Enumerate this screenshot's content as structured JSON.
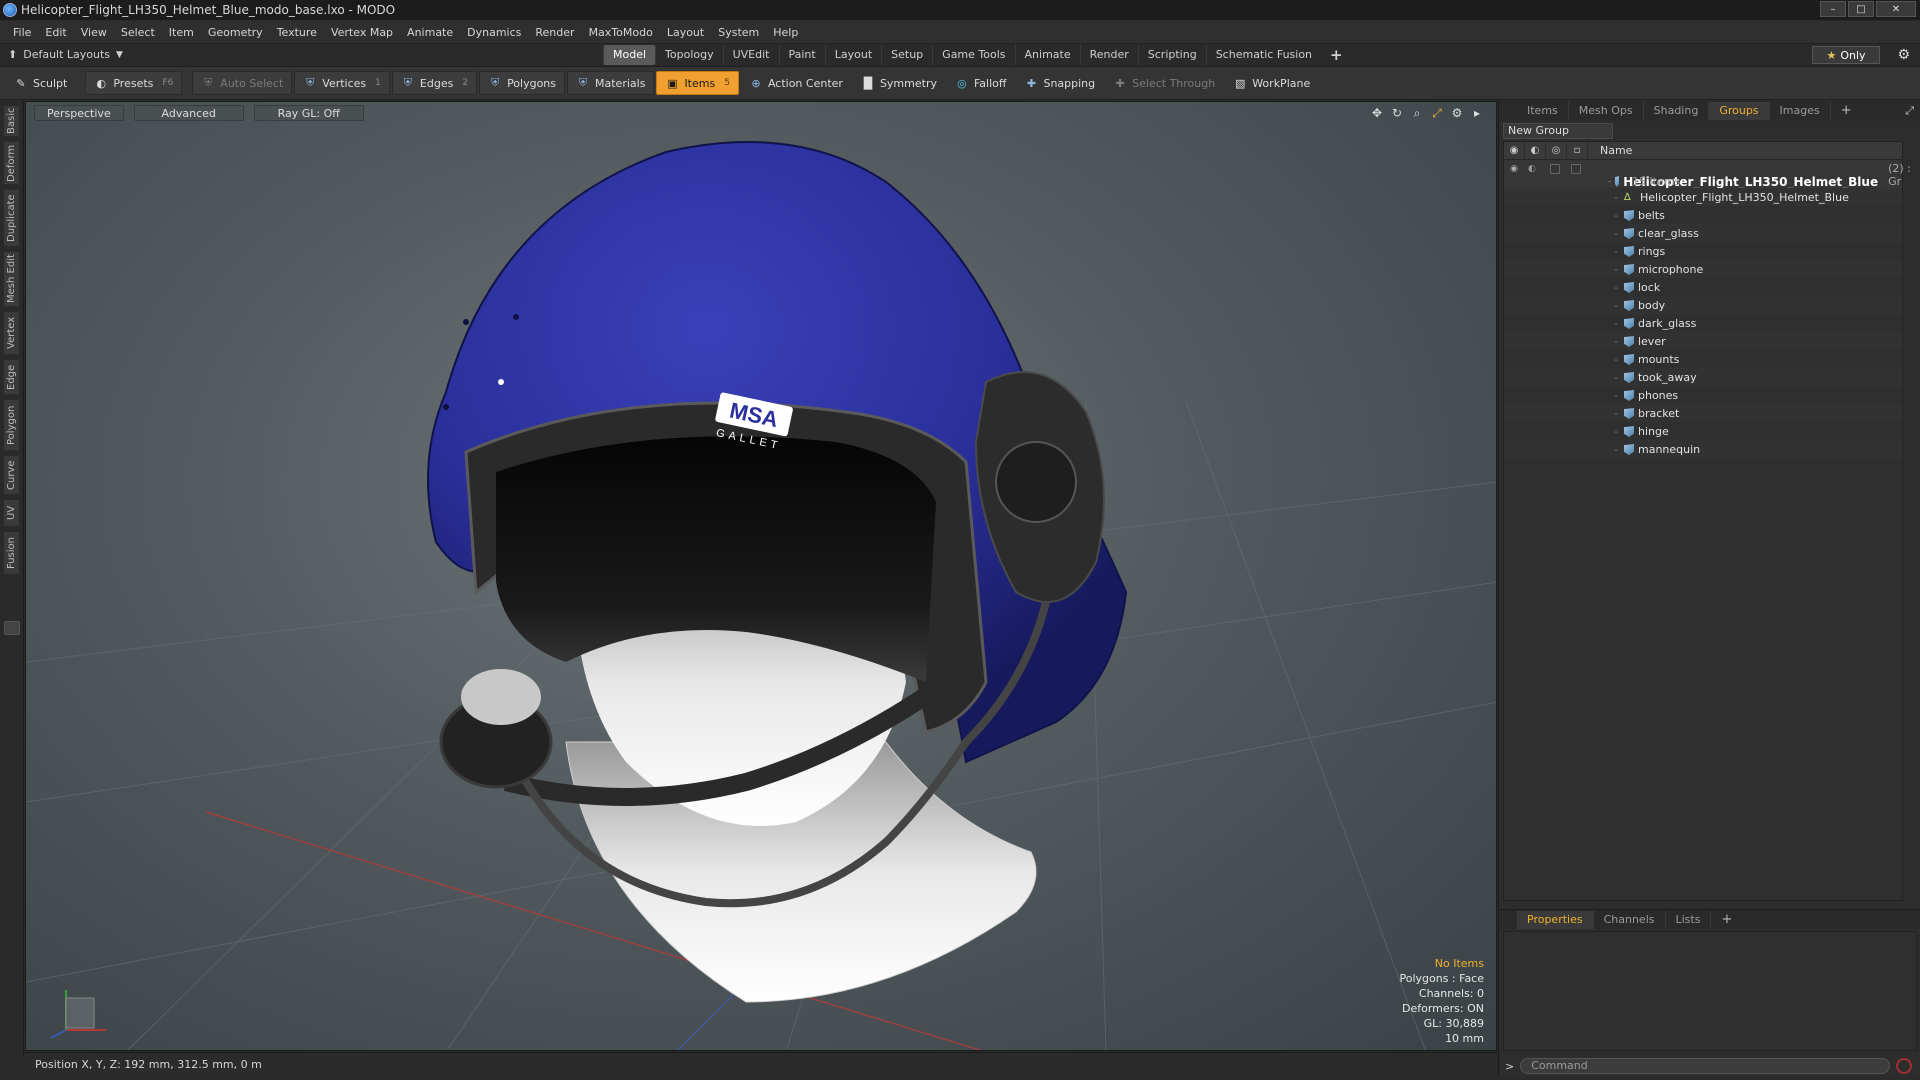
{
  "window": {
    "title": "Helicopter_Flight_LH350_Helmet_Blue_modo_base.lxo - MODO",
    "controls": [
      "–",
      "□",
      "✕"
    ]
  },
  "menu": [
    "File",
    "Edit",
    "View",
    "Select",
    "Item",
    "Geometry",
    "Texture",
    "Vertex Map",
    "Animate",
    "Dynamics",
    "Render",
    "MaxToModo",
    "Layout",
    "System",
    "Help"
  ],
  "layout_bar": {
    "layout_label": "Default Layouts",
    "tabs": [
      "Model",
      "Topology",
      "UVEdit",
      "Paint",
      "Layout",
      "Setup",
      "Game Tools",
      "Animate",
      "Render",
      "Scripting",
      "Schematic Fusion"
    ],
    "active_tab": "Model",
    "plus": "+",
    "only_label": "Only"
  },
  "toolbar": {
    "sculpt": "Sculpt",
    "presets": "Presets",
    "presets_key": "F6",
    "auto_select": "Auto Select",
    "vertices": "Vertices",
    "vertices_count": "1",
    "edges": "Edges",
    "edges_count": "2",
    "polygons": "Polygons",
    "materials": "Materials",
    "items": "Items",
    "items_count": "5",
    "action_center": "Action Center",
    "symmetry": "Symmetry",
    "falloff": "Falloff",
    "snapping": "Snapping",
    "select_through": "Select Through",
    "workplane": "WorkPlane"
  },
  "left_tabs": [
    "Basic",
    "Deform",
    "Duplicate",
    "Mesh Edit",
    "Vertex",
    "Edge",
    "Polygon",
    "Curve",
    "UV",
    "Fusion"
  ],
  "viewport": {
    "view_mode": "Perspective",
    "shading": "Advanced",
    "raygl": "Ray GL: Off",
    "logo_line1": "MSA",
    "logo_line2": "GALLET",
    "stats": {
      "no_items": "No Items",
      "polygons": "Polygons : Face",
      "channels": "Channels: 0",
      "deformers": "Deformers: ON",
      "gl": "GL: 30,889",
      "scale": "10 mm"
    }
  },
  "status": {
    "position": "Position X, Y, Z:  192 mm, 312.5 mm, 0 m"
  },
  "right_panel": {
    "tabs": [
      "Items",
      "Mesh Ops",
      "Shading",
      "Groups",
      "Images"
    ],
    "active_tab": "Groups",
    "plus": "+",
    "new_group": "New Group",
    "name_header": "Name",
    "group": {
      "name": "Helicopter_Flight_LH350_Helmet_Blue",
      "count": "(2) : Gr ...",
      "sub": "15 Items"
    },
    "items": [
      "Helicopter_Flight_LH350_Helmet_Blue",
      "belts",
      "clear_glass",
      "rings",
      "microphone",
      "lock",
      "body",
      "dark_glass",
      "lever",
      "mounts",
      "took_away",
      "phones",
      "bracket",
      "hinge",
      "mannequin"
    ],
    "props_tabs": [
      "Properties",
      "Channels",
      "Lists"
    ],
    "props_active": "Properties",
    "command_placeholder": "Command"
  },
  "colors": {
    "accent": "#f0a030",
    "helmet_blue": "#2a2f9a",
    "active_tab_text": "#f0b030"
  }
}
